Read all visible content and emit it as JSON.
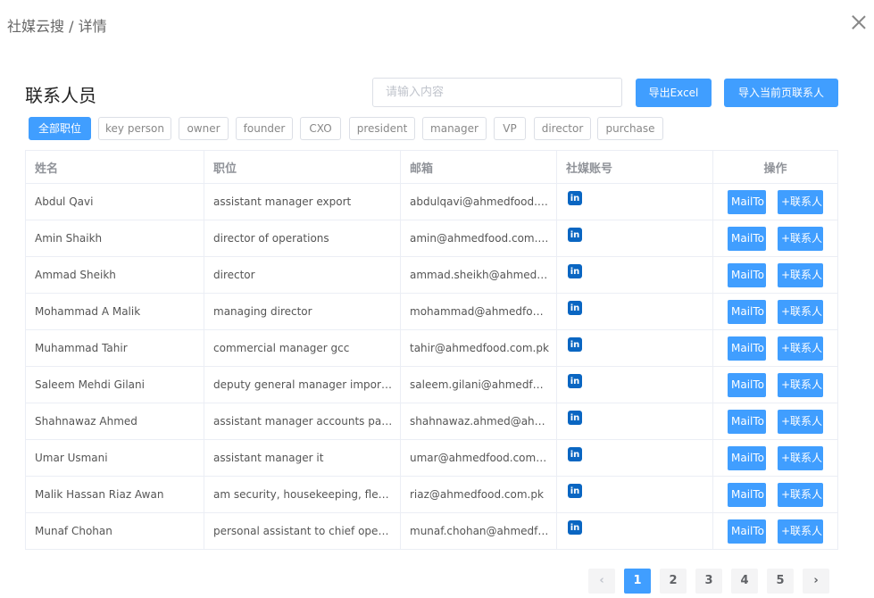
{
  "breadcrumb": "社媒云搜 / 详情",
  "section_title": "联系人员",
  "search": {
    "placeholder": "请输入内容",
    "value": ""
  },
  "toolbar": {
    "export_label": "导出Excel",
    "import_label": "导入当前页联系人"
  },
  "filters": [
    "全部职位",
    "key person",
    "owner",
    "founder",
    "CXO",
    "president",
    "manager",
    "VP",
    "director",
    "purchase"
  ],
  "filters_active": "全部职位",
  "table": {
    "headers": [
      "姓名",
      "职位",
      "邮箱",
      "社媒账号",
      "操作"
    ],
    "rows": [
      {
        "name": "Abdul Qavi",
        "title": "assistant manager export",
        "email": "abdulqavi@ahmedfood.c..."
      },
      {
        "name": "Amin Shaikh",
        "title": "director of operations",
        "email": "amin@ahmedfood.com.pk"
      },
      {
        "name": "Ammad Sheikh",
        "title": "director",
        "email": "ammad.sheikh@ahmedf..."
      },
      {
        "name": "Mohammad A Malik",
        "title": "managing director",
        "email": "mohammad@ahmedfoo..."
      },
      {
        "name": "Muhammad Tahir",
        "title": "commercial manager gcc",
        "email": "tahir@ahmedfood.com.pk"
      },
      {
        "name": "Saleem Mehdi Gilani",
        "title": "deputy general manager import & ...",
        "email": "saleem.gilani@ahmedfo..."
      },
      {
        "name": "Shahnawaz Ahmed",
        "title": "assistant manager accounts paya...",
        "email": "shahnawaz.ahmed@ahm..."
      },
      {
        "name": "Umar Usmani",
        "title": "assistant manager it",
        "email": "umar@ahmedfood.com.pk"
      },
      {
        "name": "Malik Hassan Riaz Awan",
        "title": "am security, housekeeping, fleet, ...",
        "email": "riaz@ahmedfood.com.pk"
      },
      {
        "name": "Munaf Chohan",
        "title": "personal assistant to chief operati...",
        "email": "munaf.chohan@ahmedfo..."
      }
    ],
    "social_icon": "linkedin-icon",
    "mail_label": "MailTo",
    "add_label": "+联系人"
  },
  "pagination": {
    "pages": [
      "1",
      "2",
      "3",
      "4",
      "5"
    ],
    "current": "1",
    "prev": "‹",
    "next": "›"
  },
  "colors": {
    "primary": "#409eff",
    "linkedin": "#0a66c2"
  }
}
